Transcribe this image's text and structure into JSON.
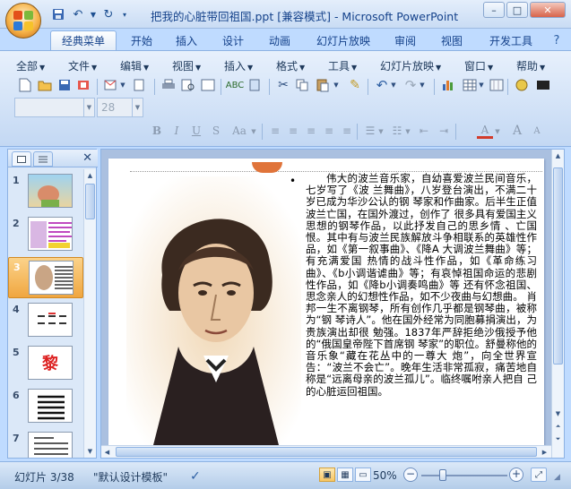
{
  "window": {
    "title": "把我的心脏带回祖国.ppt [兼容模式] - Microsoft PowerPoint",
    "controls": [
      "–",
      "□",
      "✕"
    ]
  },
  "tabs": [
    "经典菜单",
    "开始",
    "插入",
    "设计",
    "动画",
    "幻灯片放映",
    "审阅",
    "视图",
    "开发工具"
  ],
  "active_tab": "经典菜单",
  "menu": [
    "全部",
    "文件",
    "编辑",
    "视图",
    "插入",
    "格式",
    "工具",
    "幻灯片放映",
    "窗口",
    "帮助"
  ],
  "font": {
    "name": "",
    "size": "28"
  },
  "slides": {
    "numbers": [
      "1",
      "2",
      "3",
      "4",
      "5",
      "6",
      "7"
    ],
    "selected": "3",
    "thumb5_char": "黎"
  },
  "slide_text": "伟大的波兰音乐家，自幼喜爱波兰民间音乐，七岁写了《波 兰舞曲》，八岁登台演出，不满二十岁已成为华沙公认的钢 琴家和作曲家。后半生正值波兰亡国，在国外渡过，创作了 很多具有爱国主义思想的钢琴作品，以此抒发自己的思乡情 、亡国恨。其中有与波兰民族解放斗争相联系的英雄性作品，如《第一叙事曲》、《降A 大调波兰舞曲》等；有充满爱国 热情的战斗性作品，如《革命练习曲》、《b小调谐谑曲》等；有哀悼祖国命运的悲剧性作品，如《降b小调奏鸣曲》等 还有怀念祖国、思念亲人的幻想性作品，如不少夜曲与幻想曲。 肖邦一生不离钢琴，所有创作几乎都是钢琴曲，被称为“钢 琴诗人”。他在国外经常为同胞募捐演出，为贵族演出却很 勉强。1837年严辞拒绝沙俄授予他的“俄国皇帝陛下首席钢 琴家”的职位。舒曼称他的音乐象“藏在花丛中的一尊大 炮”，向全世界宣告：“波兰不会亡”。晚年生活非常孤寂，痛苦地自称是“远离母亲的波兰孤儿”。临终嘱咐亲人把自 己的心脏运回祖国。",
  "status": {
    "slide_info": "幻灯片 3/38",
    "theme": "\"默认设计模板\"",
    "zoom": "50%",
    "zoom_fraction": 0.5
  }
}
